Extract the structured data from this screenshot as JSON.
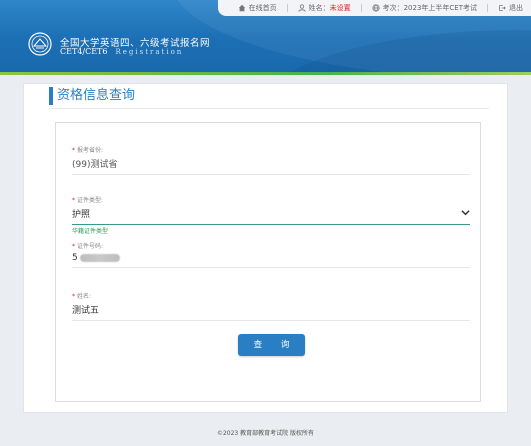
{
  "topbar": {
    "home": "在线首页",
    "name_label": "姓名：",
    "name_value": "未设置",
    "exam_label": "考次：",
    "exam_value": "2023年上半年CET考试",
    "logout": "退出"
  },
  "brand": {
    "title_cn": "全国大学英语四、六级考试报名网",
    "title_en": "CET4/CET6",
    "registration": "Registration"
  },
  "page_title": "资格信息查询",
  "form": {
    "province": {
      "label": "报考省份",
      "value": "(99)测试省"
    },
    "id_type": {
      "label": "证件类型",
      "value": "护照"
    },
    "id_type_hint": "华籍证件类型",
    "id_number": {
      "label": "证件号码",
      "value": "5"
    },
    "name": {
      "label": "姓名",
      "value": "测试五"
    },
    "query_button": "查 询"
  },
  "footer": "©2023 教育部教育考试院 版权所有",
  "colors": {
    "primary": "#2a7fc4",
    "required": "#e02020",
    "hint": "#2e9a55"
  }
}
